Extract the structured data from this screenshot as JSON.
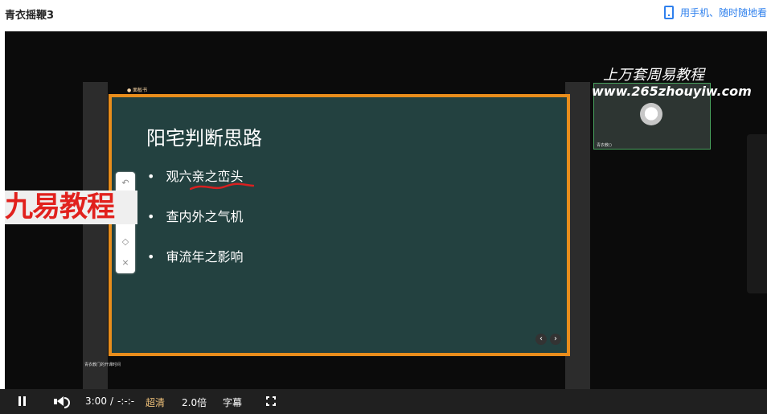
{
  "header": {
    "title": "青衣摇鞭3",
    "mobile_text": "用手机、随时随地看"
  },
  "slide": {
    "top_tag": "● 面板书",
    "title": "阳宅判断思路",
    "bullets": [
      "观六亲之峦头",
      "查内外之气机",
      "审流年之影响"
    ]
  },
  "watermarks": {
    "left": "九易教程",
    "right_line1": "上万套周易教程",
    "right_line2": "www.265zhouyiw.com"
  },
  "camera": {
    "label": "青衣教()"
  },
  "bottom_small": "青衣教门的开课时间",
  "controls": {
    "time_current": "3:00",
    "time_separator": "/",
    "time_total": "-:-:-",
    "quality": "超清",
    "speed": "2.0倍",
    "subtitle": "字幕"
  },
  "icons": {
    "pause": "pause-icon",
    "volume": "volume-icon",
    "fullscreen": "fullscreen-icon",
    "phone": "phone-icon"
  },
  "colors": {
    "accent_orange": "#e88d1c",
    "slide_bg": "#234140",
    "link_blue": "#2f80ed",
    "watermark_red": "#e1211d"
  }
}
